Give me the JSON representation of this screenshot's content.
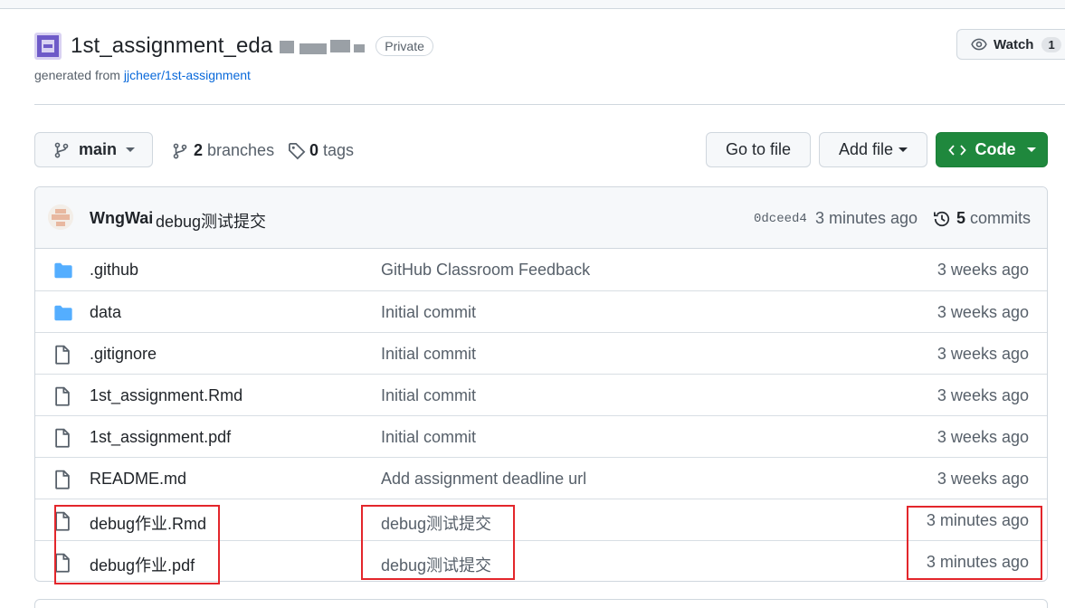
{
  "repo": {
    "name": "1st_assignment_eda",
    "visibility": "Private",
    "generated_prefix": "generated from",
    "template_link": "jjcheer/1st-assignment"
  },
  "watch": {
    "label": "Watch",
    "count": "1"
  },
  "toolbar": {
    "branch": "main",
    "branches_count": "2",
    "branches_label": "branches",
    "tags_count": "0",
    "tags_label": "tags",
    "goto_file": "Go to file",
    "add_file": "Add file",
    "code": "Code"
  },
  "latest_commit": {
    "author": "WngWai",
    "message": "debug测试提交",
    "sha": "0dceed4",
    "time": "3 minutes ago",
    "commits_count": "5",
    "commits_label": "commits"
  },
  "files": [
    {
      "type": "folder",
      "name": ".github",
      "message": "GitHub Classroom Feedback",
      "time": "3 weeks ago"
    },
    {
      "type": "folder",
      "name": "data",
      "message": "Initial commit",
      "time": "3 weeks ago"
    },
    {
      "type": "file",
      "name": ".gitignore",
      "message": "Initial commit",
      "time": "3 weeks ago"
    },
    {
      "type": "file",
      "name": "1st_assignment.Rmd",
      "message": "Initial commit",
      "time": "3 weeks ago"
    },
    {
      "type": "file",
      "name": "1st_assignment.pdf",
      "message": "Initial commit",
      "time": "3 weeks ago"
    },
    {
      "type": "file",
      "name": "README.md",
      "message": "Add assignment deadline url",
      "time": "3 weeks ago"
    },
    {
      "type": "file",
      "name": "debug作业.Rmd",
      "message": "debug测试提交",
      "time": "3 minutes ago"
    },
    {
      "type": "file",
      "name": "debug作业.pdf",
      "message": "debug测试提交",
      "time": "3 minutes ago"
    }
  ],
  "colors": {
    "accent_link": "#0969da",
    "code_button": "#1f883d",
    "folder_icon": "#54aeff",
    "annotation_red": "#e3262b"
  },
  "icons": [
    "repo-avatar-icon",
    "eye-icon",
    "branch-icon",
    "tag-icon",
    "code-icon",
    "history-icon",
    "folder-icon",
    "file-icon"
  ]
}
